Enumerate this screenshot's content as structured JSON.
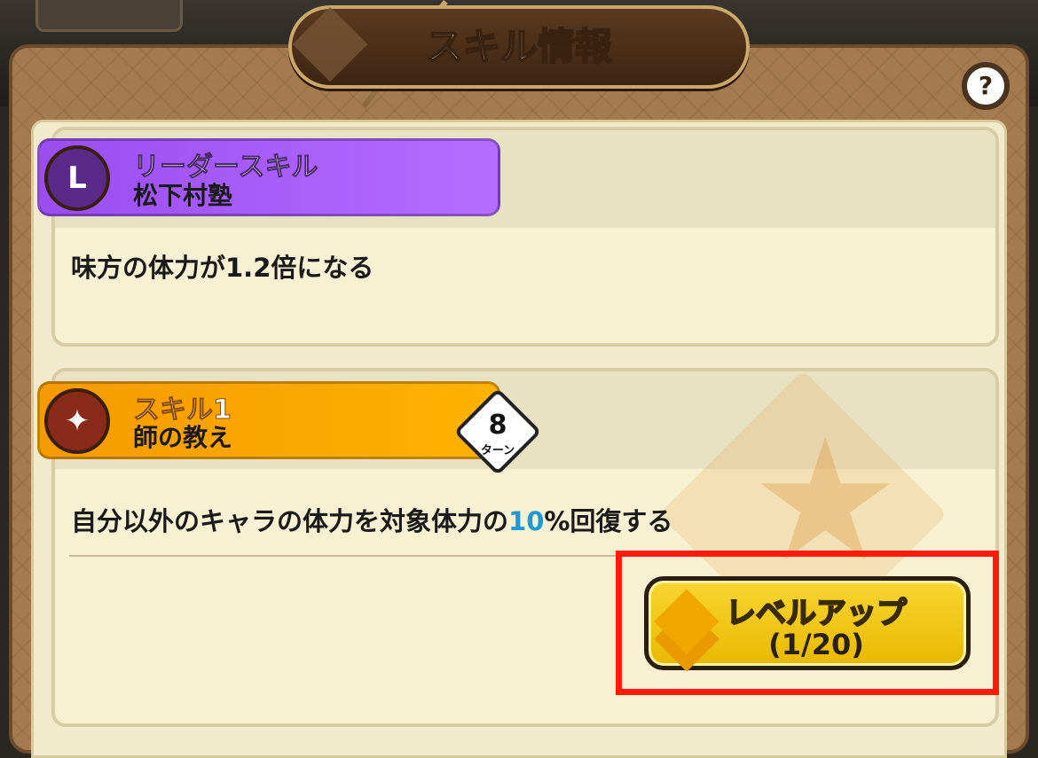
{
  "dialog": {
    "title": "スキル情報",
    "help_icon": "?"
  },
  "leader_skill": {
    "label": "リーダースキル",
    "name": "松下村塾",
    "description": "味方の体力が1.2倍になる",
    "icon_glyph": "L"
  },
  "skill1": {
    "label": "スキル1",
    "name": "師の教え",
    "turns": "8",
    "turn_unit": "ターン",
    "description_pre": "自分以外のキャラの体力を対象体力の",
    "description_value": "10",
    "description_post": "%回復する",
    "icon_glyph": "✦"
  },
  "level_up": {
    "label": "レベルアップ",
    "progress": "(1/20)"
  },
  "colors": {
    "leader_ribbon": "#b56dff",
    "skill_ribbon": "#ffb200",
    "highlight": "#ff1a0a",
    "value_blue": "#1a9ad8"
  }
}
